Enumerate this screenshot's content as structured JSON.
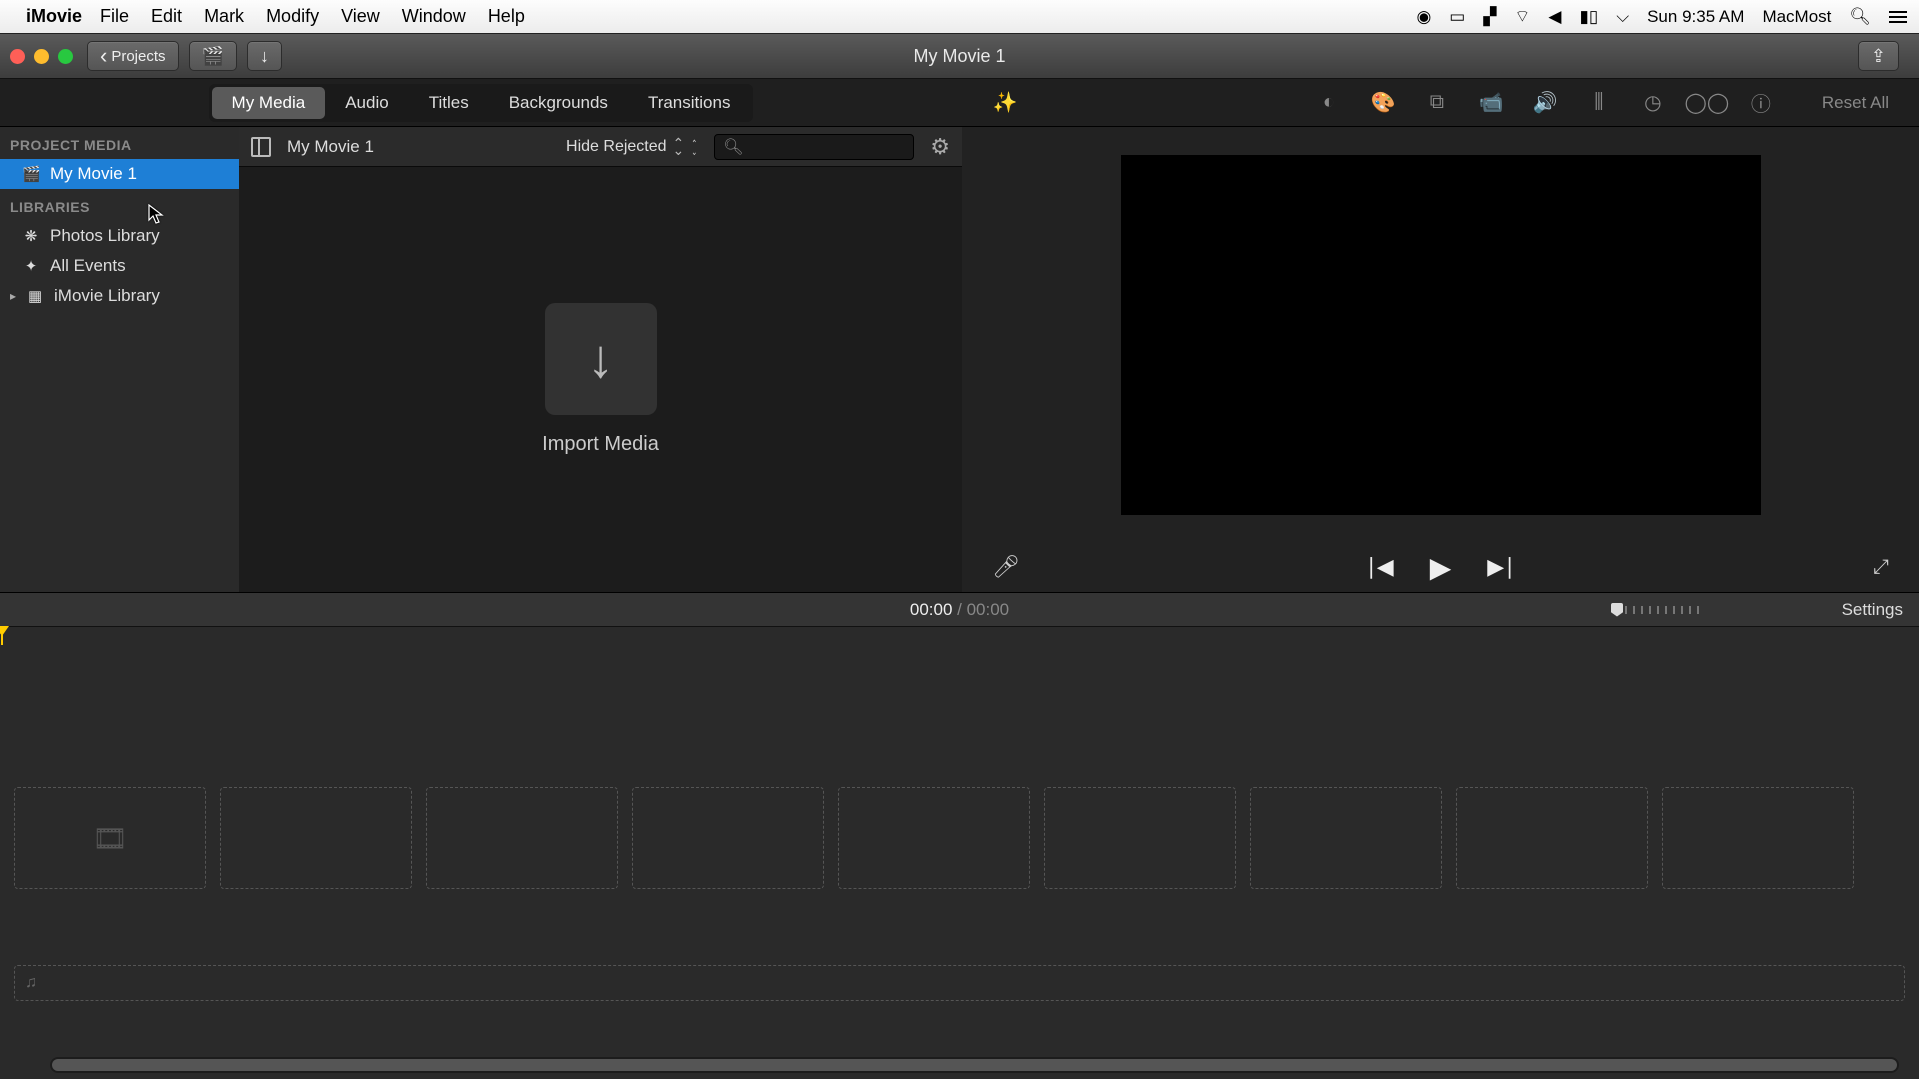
{
  "menubar": {
    "app": "iMovie",
    "items": [
      "File",
      "Edit",
      "Mark",
      "Modify",
      "View",
      "Window",
      "Help"
    ],
    "clock": "Sun 9:35 AM",
    "user": "MacMost"
  },
  "toolbar": {
    "projects": "Projects",
    "title": "My Movie 1"
  },
  "tabs": {
    "items": [
      "My Media",
      "Audio",
      "Titles",
      "Backgrounds",
      "Transitions"
    ],
    "active": 0,
    "reset": "Reset All"
  },
  "sidebar": {
    "project_media_header": "PROJECT MEDIA",
    "project_item": "My Movie 1",
    "libraries_header": "LIBRARIES",
    "photos": "Photos Library",
    "all_events": "All Events",
    "imovie_lib": "iMovie Library"
  },
  "browser": {
    "title": "My Movie 1",
    "filter": "Hide Rejected",
    "import_label": "Import Media"
  },
  "time": {
    "current": "00:00",
    "sep": " / ",
    "duration": "00:00",
    "settings": "Settings"
  }
}
